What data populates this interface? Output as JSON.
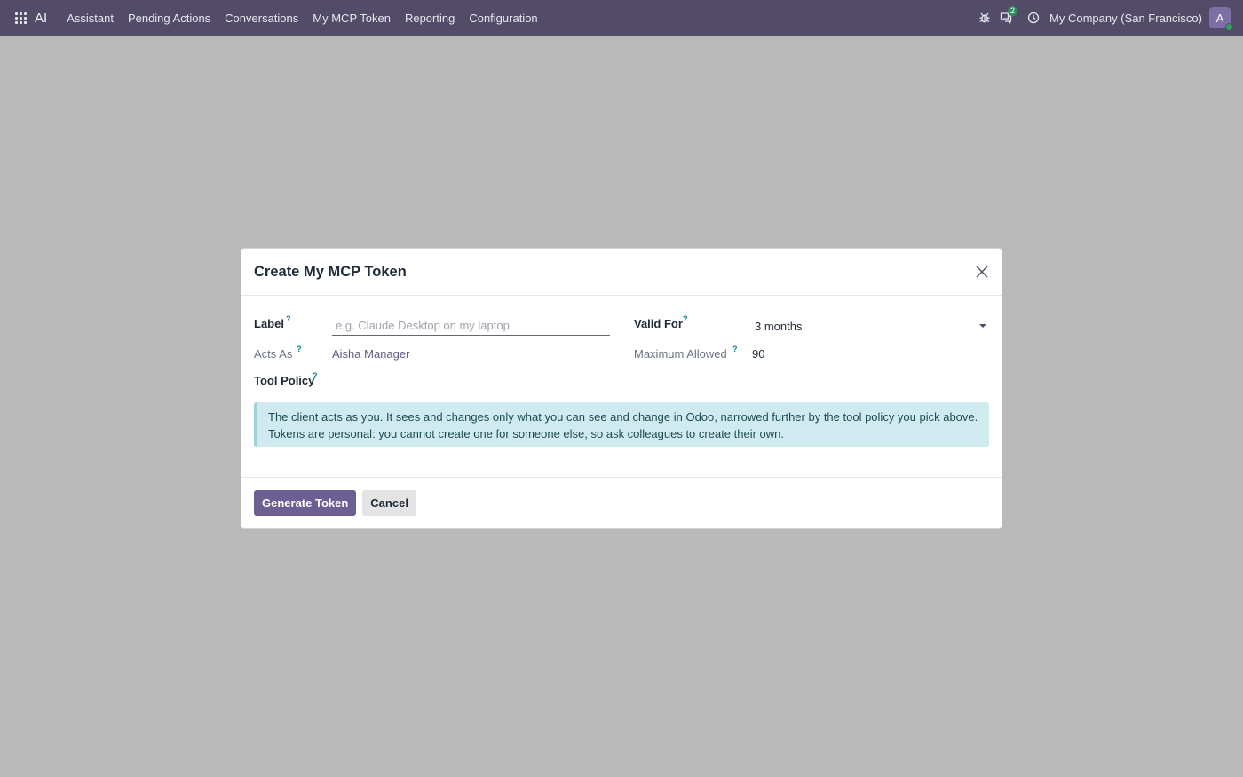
{
  "navbar": {
    "brand": "AI",
    "menu": [
      "Assistant",
      "Pending Actions",
      "Conversations",
      "My MCP Token",
      "Reporting",
      "Configuration"
    ],
    "messages_badge": "2",
    "company": "My Company (San Francisco)",
    "avatar_initial": "A",
    "icons": [
      "apps-grid-icon",
      "bug-icon",
      "chat-icon",
      "clock-icon"
    ]
  },
  "modal": {
    "title": "Create My MCP Token",
    "fields": {
      "label": {
        "label": "Label",
        "help": "?",
        "placeholder": "e.g. Claude Desktop on my laptop",
        "value": ""
      },
      "valid_for": {
        "label": "Valid For",
        "help": "?",
        "value": "3 months"
      },
      "acts_as": {
        "label": "Acts As",
        "help": "?",
        "value": "Aisha Manager"
      },
      "maximum_allowed": {
        "label": "Maximum Allowed",
        "help": "?",
        "value": "90"
      },
      "tool_policy": {
        "label": "Tool Policy",
        "help": "?"
      }
    },
    "info": "The client acts as you. It sees and changes only what you can see and change in Odoo, narrowed further by the tool policy you pick above. Tokens are personal: you cannot create one for someone else, so ask colleagues to create their own.",
    "buttons": {
      "generate": "Generate Token",
      "cancel": "Cancel"
    }
  },
  "colors": {
    "navbar_bg": "#524c68",
    "primary": "#6d5e93",
    "backdrop": "#b9b9b9",
    "info_bg": "#d0ebef",
    "help_color": "#017e84"
  }
}
